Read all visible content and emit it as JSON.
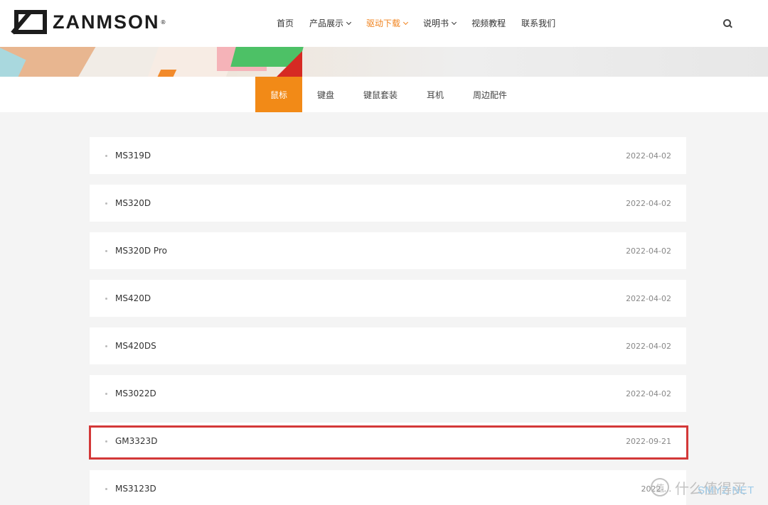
{
  "brand": {
    "name": "ZANMSON",
    "reg": "®"
  },
  "nav": {
    "items": [
      {
        "label": "首页",
        "dropdown": false,
        "active": false
      },
      {
        "label": "产品展示",
        "dropdown": true,
        "active": false
      },
      {
        "label": "驱动下载",
        "dropdown": true,
        "active": true
      },
      {
        "label": "说明书",
        "dropdown": true,
        "active": false
      },
      {
        "label": "视频教程",
        "dropdown": false,
        "active": false
      },
      {
        "label": "联系我们",
        "dropdown": false,
        "active": false
      }
    ],
    "search_icon": "search-icon"
  },
  "tabs": [
    {
      "label": "鼠标",
      "active": true
    },
    {
      "label": "键盘",
      "active": false
    },
    {
      "label": "键鼠套装",
      "active": false
    },
    {
      "label": "耳机",
      "active": false
    },
    {
      "label": "周边配件",
      "active": false
    }
  ],
  "downloads": [
    {
      "name": "MS319D",
      "date": "2022-04-02"
    },
    {
      "name": "MS320D",
      "date": "2022-04-02"
    },
    {
      "name": "MS320D Pro",
      "date": "2022-04-02"
    },
    {
      "name": "MS420D",
      "date": "2022-04-02"
    },
    {
      "name": "MS420DS",
      "date": "2022-04-02"
    },
    {
      "name": "MS3022D",
      "date": "2022-04-02"
    },
    {
      "name": "GM3323D",
      "date": "2022-09-21",
      "highlighted": true
    },
    {
      "name": "MS3123D",
      "date": "2022-..."
    }
  ],
  "watermark": {
    "text": "什么值得买",
    "badge": "值",
    "site": "SMYZ.NET"
  },
  "colors": {
    "accent": "#f28a17",
    "active_nav": "#f0831e",
    "highlight_border": "#d33838",
    "page_bg": "#f4f4f4"
  }
}
